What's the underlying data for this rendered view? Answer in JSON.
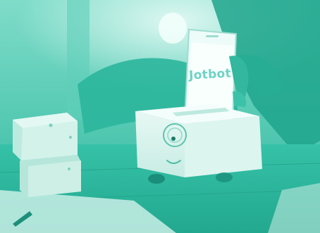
{
  "image": {
    "tint_color": "#2ec4a8",
    "highlight_color": "#bff2e9",
    "shadow_color": "#1a8e7a"
  },
  "phone": {
    "screen_text": "Jotbot"
  },
  "robot": {
    "face": [
      "eye-icon",
      "smile-icon"
    ]
  }
}
